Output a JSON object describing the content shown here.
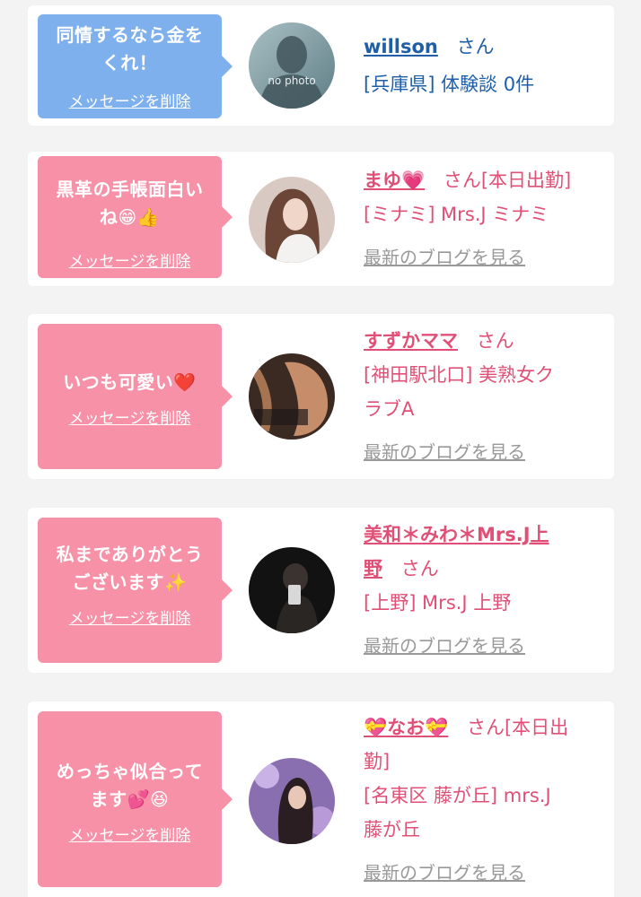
{
  "colors": {
    "blue_bubble": "#7fb0ee",
    "pink_bubble": "#f691a8",
    "name_blue": "#1e5fa8",
    "name_pink": "#e05076",
    "link_gray": "#999999"
  },
  "delete_label": "メッセージを削除",
  "items": [
    {
      "message_line1": "同情するなら金を",
      "message_line2": "くれ！",
      "name": "willson",
      "honorific": "さん",
      "detail": "[兵庫県] 体験談 0件",
      "avatar_text": "no photo"
    },
    {
      "message_line1": "黒革の手帳面白い",
      "message_line2": "ね😁👍",
      "name": "まゆ💗",
      "honorific": "さん[本日出勤]",
      "detail": "[ミナミ] Mrs.J ミナミ",
      "blog_link": "最新のブログを見る"
    },
    {
      "message_line1": "いつも可愛い❤️",
      "name": "すずかママ",
      "honorific": "さん",
      "detail_line1": "[神田駅北口] 美熟女ク",
      "detail_line2": "ラブA",
      "blog_link": "最新のブログを見る"
    },
    {
      "message_line1": "私までありがとう",
      "message_line2": "ございます✨",
      "name_line1": "美和＊みわ＊Mrs.J上",
      "name_line2": "野",
      "honorific": "さん",
      "detail": "[上野] Mrs.J 上野",
      "blog_link": "最新のブログを見る"
    },
    {
      "message_line1": "めっちゃ似合って",
      "message_line2": "ます💕😆",
      "name": "💝なお💝",
      "honorific_line1": "さん[本日出",
      "honorific_line2": "勤]",
      "detail_line1": "[名東区 藤が丘] mrs.J",
      "detail_line2": "藤が丘",
      "blog_link": "最新のブログを見る"
    }
  ]
}
